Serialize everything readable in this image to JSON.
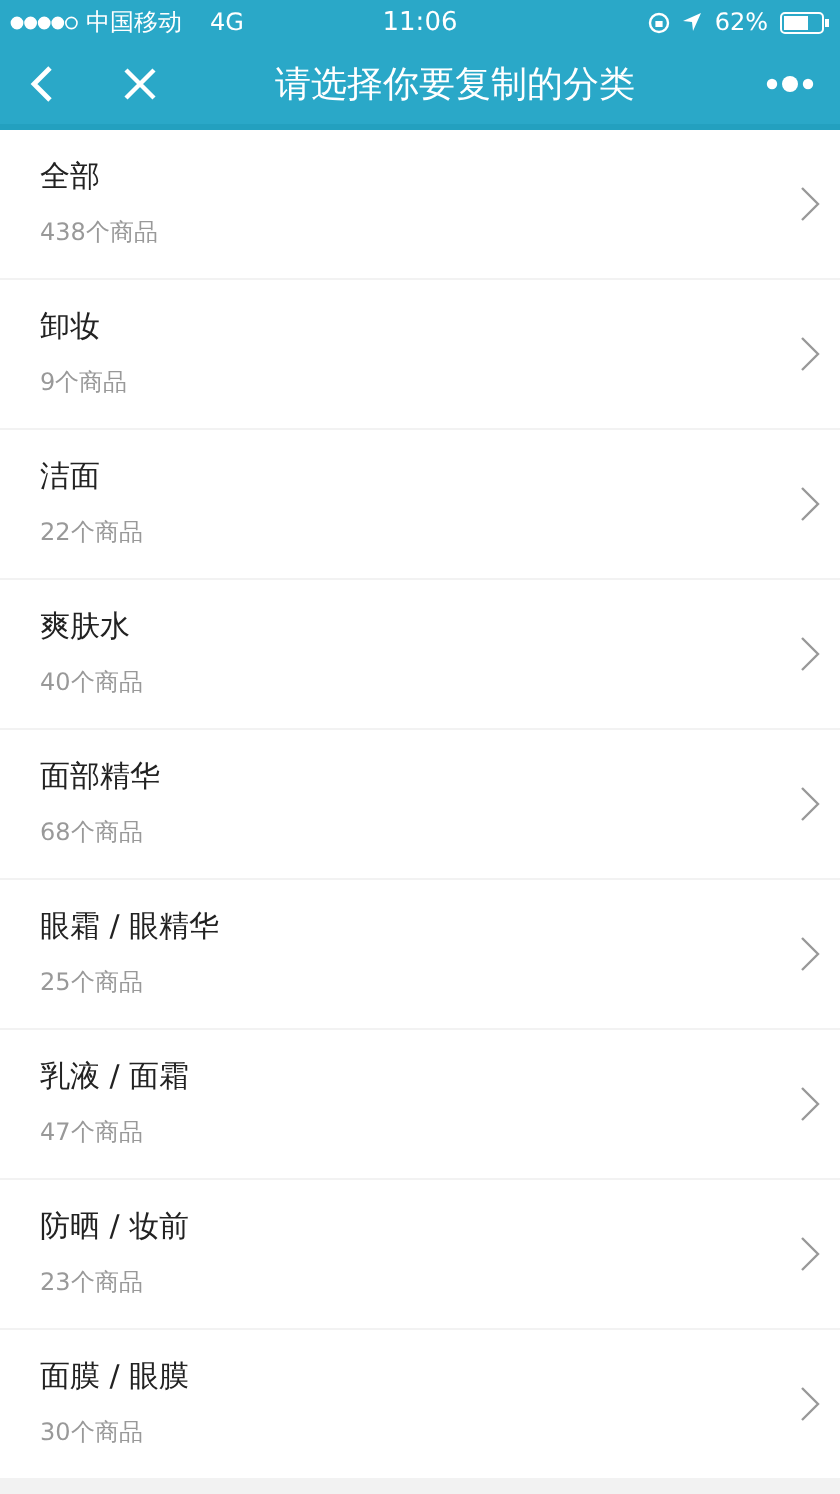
{
  "status_bar": {
    "carrier": "中国移动",
    "network": "4G",
    "time": "11:06",
    "battery": "62%"
  },
  "nav_bar": {
    "title": "请选择你要复制的分类"
  },
  "categories": [
    {
      "name": "全部",
      "count": "438个商品"
    },
    {
      "name": "卸妆",
      "count": "9个商品"
    },
    {
      "name": "洁面",
      "count": "22个商品"
    },
    {
      "name": "爽肤水",
      "count": "40个商品"
    },
    {
      "name": "面部精华",
      "count": "68个商品"
    },
    {
      "name": "眼霜 / 眼精华",
      "count": "25个商品"
    },
    {
      "name": "乳液 / 面霜",
      "count": "47个商品"
    },
    {
      "name": "防晒 / 妆前",
      "count": "23个商品"
    },
    {
      "name": "面膜 / 眼膜",
      "count": "30个商品"
    }
  ]
}
